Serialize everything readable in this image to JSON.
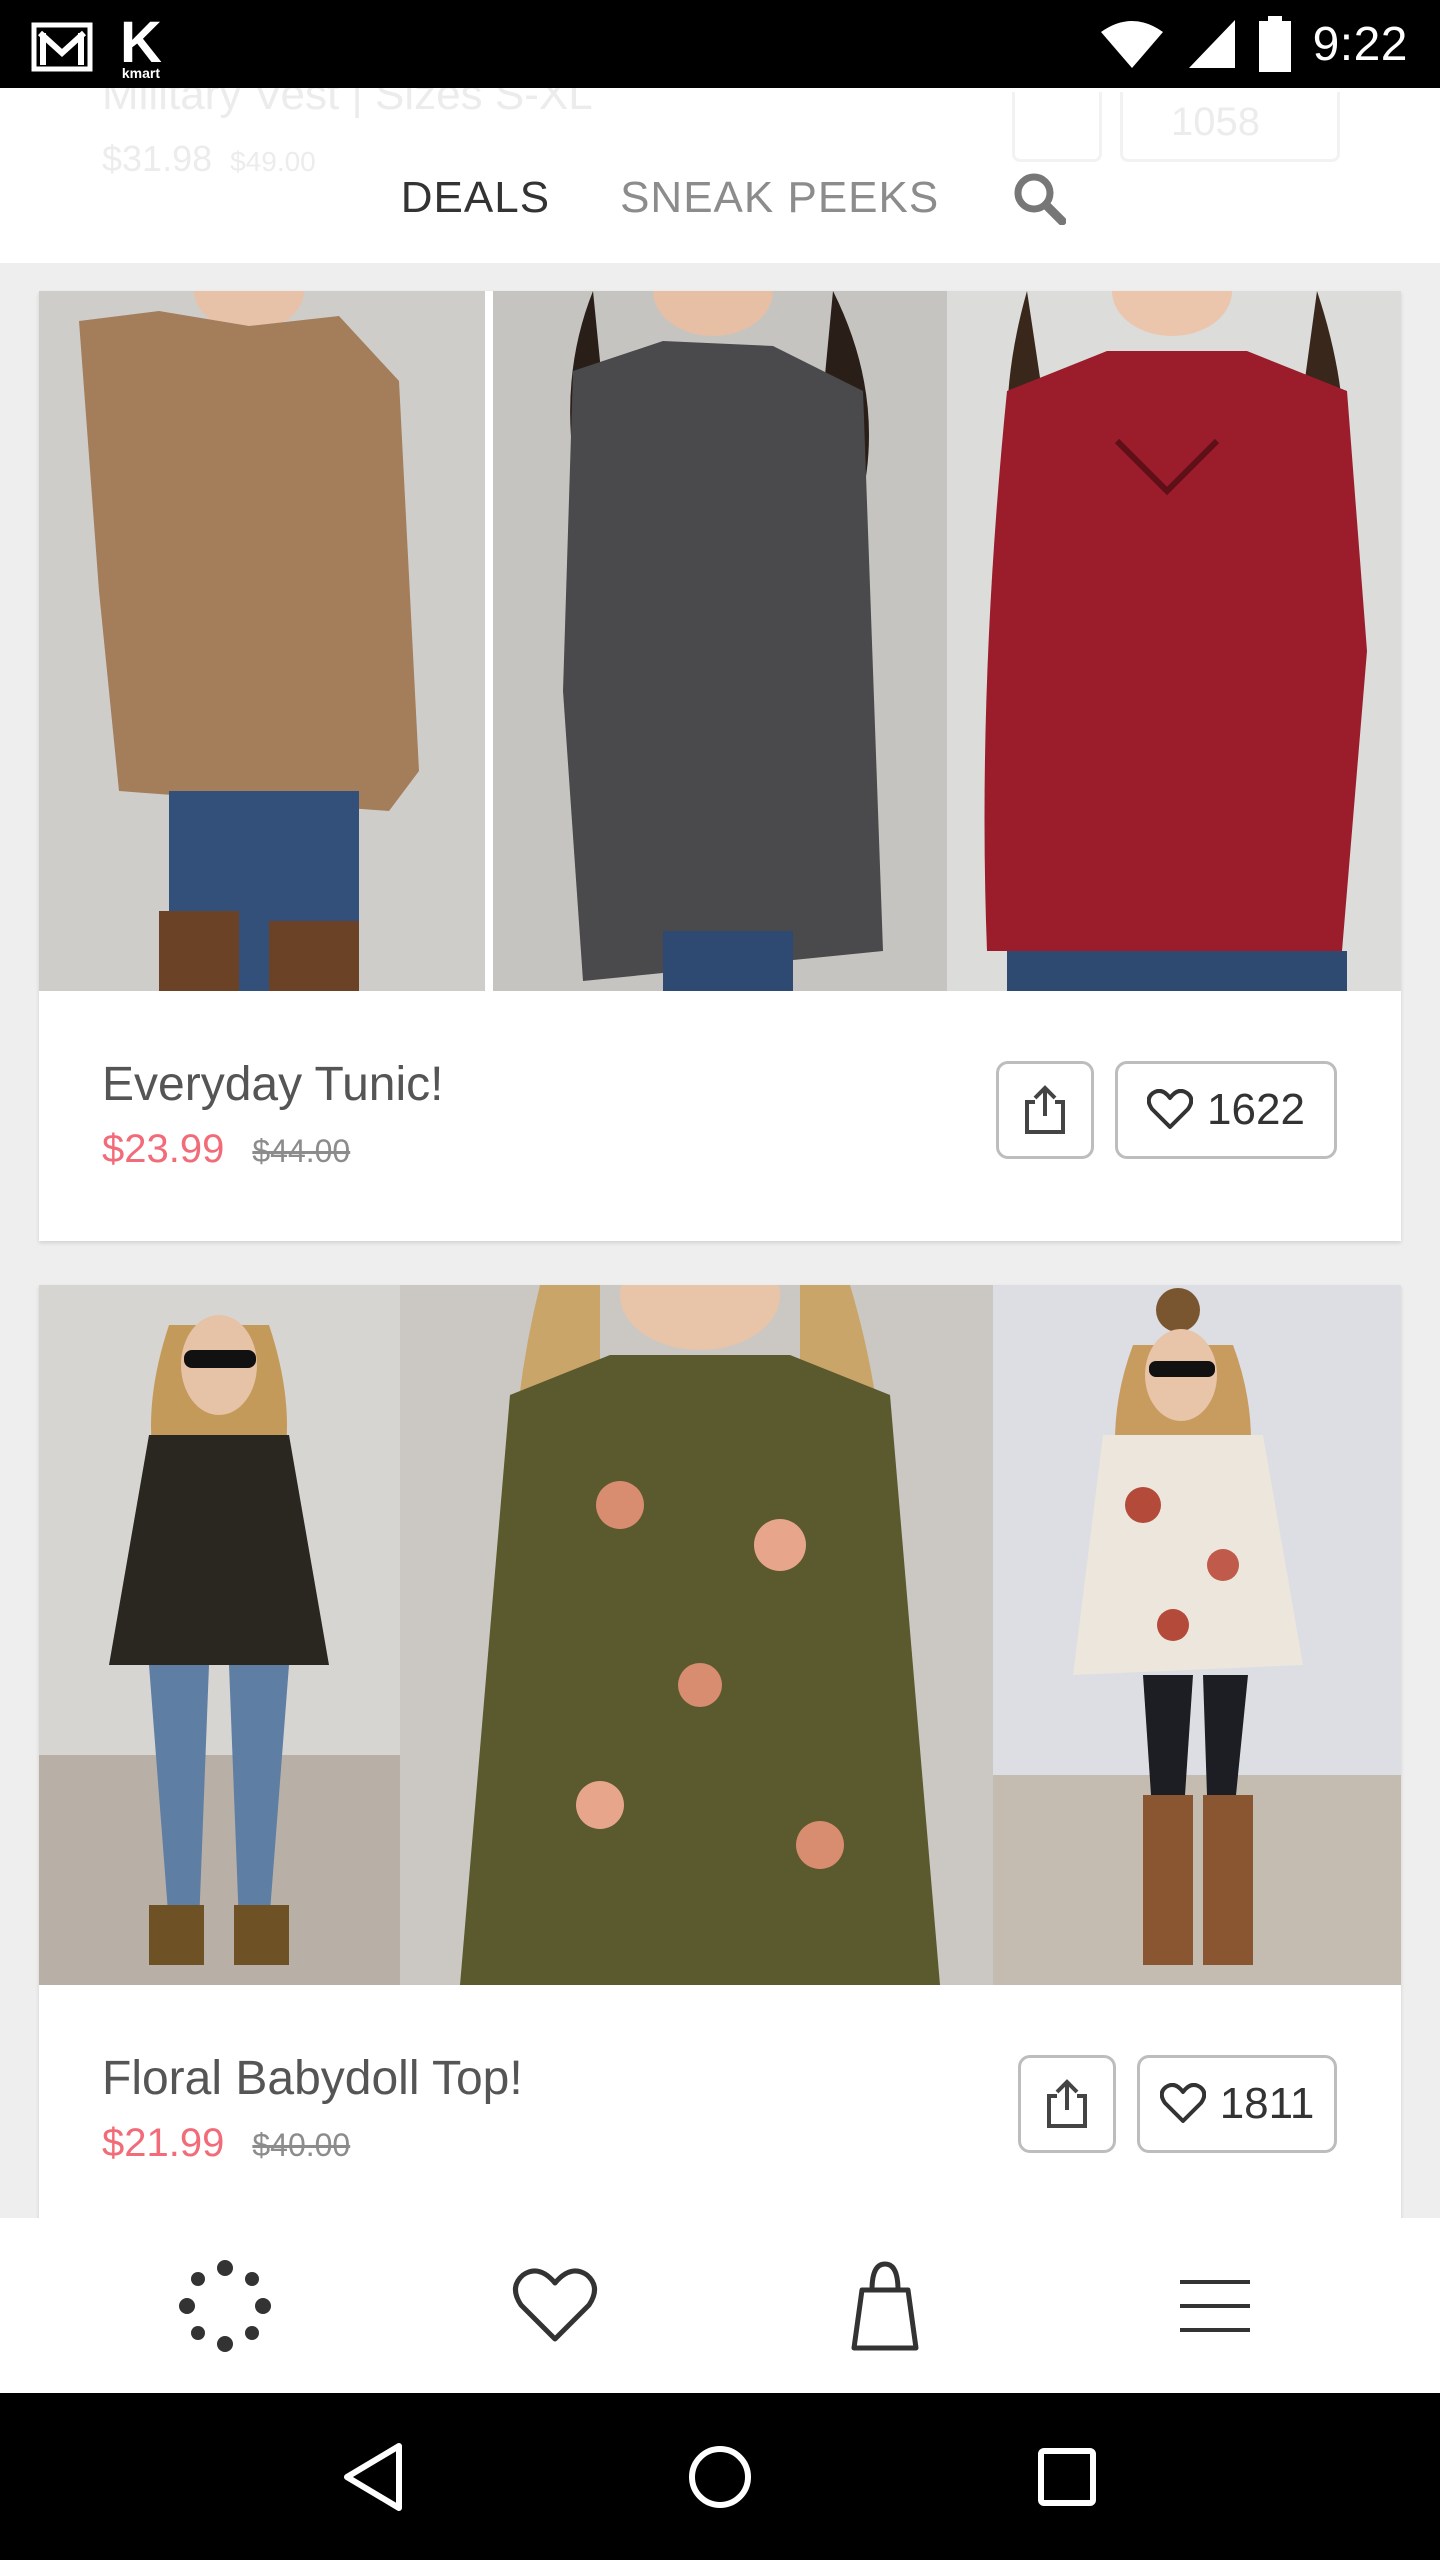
{
  "status_bar": {
    "time": "9:22",
    "app_badge_letter": "K",
    "app_badge_text": "kmart"
  },
  "header": {
    "ghost_title": "Military Vest | Sizes S-XL",
    "ghost_price": "$31.98",
    "ghost_orig": "$49.00",
    "ghost_likes": "1058",
    "tabs": [
      {
        "label": "DEALS",
        "active": true
      },
      {
        "label": "SNEAK PEEKS",
        "active": false
      }
    ]
  },
  "products": [
    {
      "title": "Everyday Tunic!",
      "sale_price": "$23.99",
      "original_price": "$44.00",
      "likes": "1622",
      "photos": [
        "#a47d5b",
        "#4a4a4c",
        "#9b1d2c"
      ]
    },
    {
      "title": "Floral Babydoll Top!",
      "sale_price": "$21.99",
      "original_price": "$40.00",
      "likes": "1811",
      "photos": [
        "#2a2620",
        "#5a5a2e",
        "#ece6dc"
      ]
    }
  ],
  "bottom_nav": [
    "feed-icon",
    "heart-icon",
    "shopping-bag-icon",
    "menu-icon"
  ],
  "colors": {
    "sale_price": "#f26b78",
    "button_border": "#bdbdbd",
    "active_tab": "#333333",
    "inactive_tab": "#8c8c8c"
  }
}
